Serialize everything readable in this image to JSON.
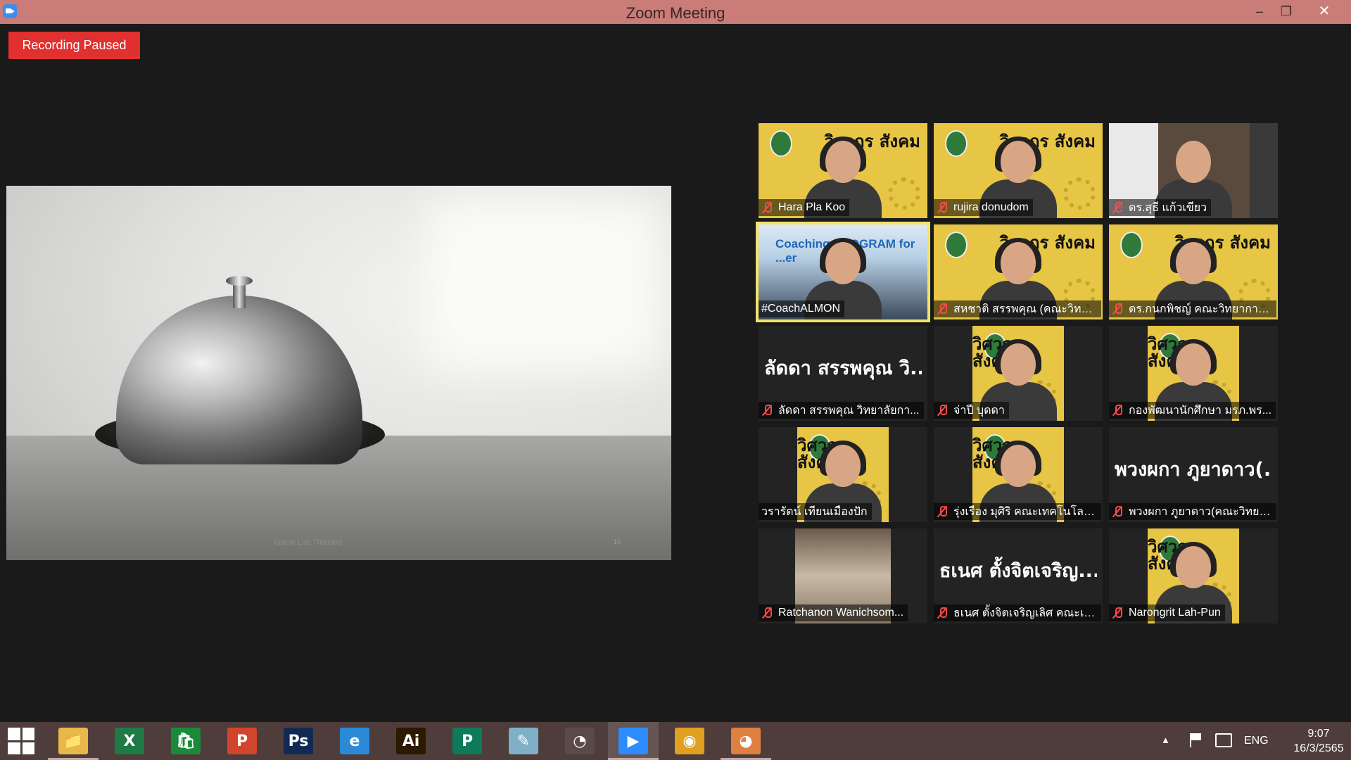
{
  "window": {
    "title": "Zoom Meeting",
    "minimize": "–",
    "maximize": "❐",
    "close": "✕"
  },
  "recording": {
    "label": "Recording Paused",
    "color": "#e03030"
  },
  "share": {
    "caption": "Game Lab Thailand",
    "page": "10"
  },
  "participants": [
    {
      "name": "Hara Pla Koo",
      "muted": true,
      "video": "poster"
    },
    {
      "name": "rujira donudom",
      "muted": true,
      "video": "poster"
    },
    {
      "name": "ดร.สุธี แก้วเขียว",
      "muted": true,
      "video": "office"
    },
    {
      "name": "#CoachALMON",
      "muted": false,
      "active": true,
      "video": "coach",
      "banner": "Coaching PROGRAM for ...er"
    },
    {
      "name": "สหชาติ สรรพคุณ (คณะวิทย์...",
      "muted": true,
      "video": "poster"
    },
    {
      "name": "ดร.กนกพิชญ์ คณะวิทยาการ...",
      "muted": true,
      "video": "poster"
    },
    {
      "name": "ลัดดา สรรพคุณ วิทยาลัยกา...",
      "display": "ลัดดา สรรพคุณ วิ...",
      "muted": true,
      "video": "none"
    },
    {
      "name": "จ่าปี บุดดา",
      "muted": true,
      "video": "poster-narrow"
    },
    {
      "name": "กองพัฒนานักศึกษา มรภ.พร...",
      "muted": true,
      "video": "poster-narrow"
    },
    {
      "name": "วรารัตน์ เทียนเมืองปัก",
      "muted": false,
      "video": "poster-narrow"
    },
    {
      "name": "รุ่งเรือง มุศิริ คณะเทคโนโลยีอุ...",
      "muted": true,
      "video": "poster-narrow"
    },
    {
      "name": "พวงผกา ภูยาดาว(คณะวิทยา...",
      "display": "พวงผกา ภูยาดาว(...",
      "muted": true,
      "video": "none"
    },
    {
      "name": "Ratchanon Wanichsom...",
      "muted": true,
      "video": "photo-narrow"
    },
    {
      "name": "ธเนศ ตั้งจิตเจริญเลิศ คณะเท...",
      "display": "ธเนศ ตั้งจิตเจริญ...",
      "muted": true,
      "video": "none"
    },
    {
      "name": "Narongrit Lah-Pun",
      "muted": true,
      "video": "poster-narrow"
    }
  ],
  "poster_brand": "วิศวกร สังคม",
  "taskbar": {
    "apps": [
      {
        "name": "file-explorer",
        "glyph": "📁",
        "color": "#e8b84a"
      },
      {
        "name": "excel",
        "glyph": "X",
        "color": "#1f7a45"
      },
      {
        "name": "store",
        "glyph": "🛍",
        "color": "#1a8a3a"
      },
      {
        "name": "powerpoint",
        "glyph": "P",
        "color": "#d0452b"
      },
      {
        "name": "photoshop",
        "glyph": "Ps",
        "color": "#102a55"
      },
      {
        "name": "internet-explorer",
        "glyph": "e",
        "color": "#2b8ad8"
      },
      {
        "name": "illustrator",
        "glyph": "Ai",
        "color": "#2b1a00"
      },
      {
        "name": "publisher",
        "glyph": "P",
        "color": "#0f7a5a"
      },
      {
        "name": "notepad",
        "glyph": "✎",
        "color": "#7fb0c8"
      },
      {
        "name": "photoscape",
        "glyph": "◔",
        "color": "#5a4a48"
      },
      {
        "name": "zoom",
        "glyph": "▶",
        "color": "#2d8cff"
      },
      {
        "name": "chrome",
        "glyph": "◉",
        "color": "#e0a020"
      },
      {
        "name": "paint",
        "glyph": "◕",
        "color": "#e08040"
      }
    ],
    "tray": {
      "lang": "ENG",
      "time": "9:07",
      "date": "16/3/2565",
      "up": "▲"
    }
  }
}
